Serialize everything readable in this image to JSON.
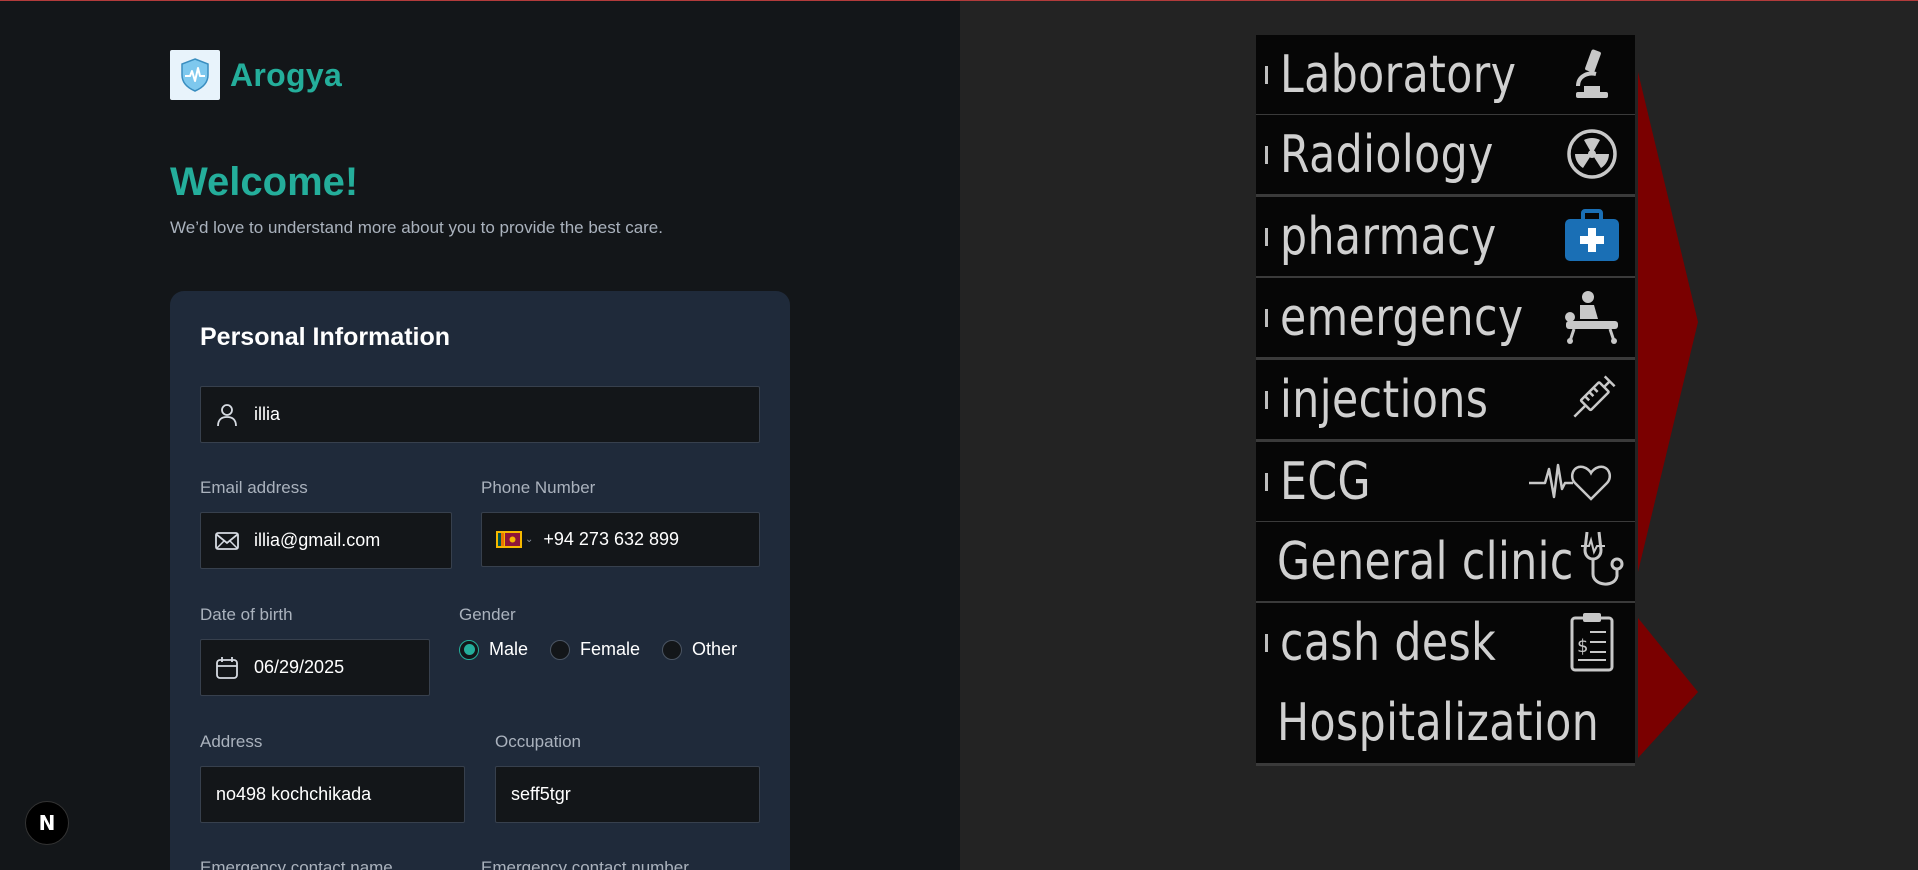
{
  "app": {
    "name": "Arogya"
  },
  "hero": {
    "title": "Welcome!",
    "subtitle": "We’d love to understand more about you to provide the best care."
  },
  "personal_info": {
    "title": "Personal Information",
    "name_value": "illia",
    "email_label": "Email address",
    "email_value": "illia@gmail.com",
    "phone_label": "Phone Number",
    "phone_value": "+94 273 632 899",
    "phone_country_icon": "sri-lanka-flag",
    "dob_label": "Date of birth",
    "dob_value": "06/29/2025",
    "gender_label": "Gender",
    "gender_options": [
      "Male",
      "Female",
      "Other"
    ],
    "gender_selected": "Male",
    "address_label": "Address",
    "address_value": "no498 kochchikada",
    "occupation_label": "Occupation",
    "occupation_value": "seff5tgr",
    "emergency_name_label": "Emergency contact name",
    "emergency_number_label": "Emergency contact number"
  },
  "dev_badge": {
    "label": "N"
  },
  "signpost": {
    "items": [
      {
        "label": "Laboratory",
        "icon": "microscope-icon"
      },
      {
        "label": "Radiology",
        "icon": "radiation-icon"
      },
      {
        "label": "pharmacy",
        "icon": "first-aid-kit-icon"
      },
      {
        "label": "emergency",
        "icon": "stretcher-icon"
      },
      {
        "label": "injections",
        "icon": "syringe-icon"
      },
      {
        "label": "ECG",
        "icon": "heartbeat-icon"
      },
      {
        "label": "General clinic",
        "icon": "stethoscope-icon"
      },
      {
        "label": "cash desk",
        "icon": "receipt-clipboard-icon"
      },
      {
        "label": "Hospitalization",
        "icon": ""
      }
    ]
  },
  "colors": {
    "accent": "#24ae9b",
    "card_bg": "#1f2a3a",
    "page_bg": "#131619",
    "right_bg": "#232323",
    "arrow_red": "#7a0000"
  }
}
